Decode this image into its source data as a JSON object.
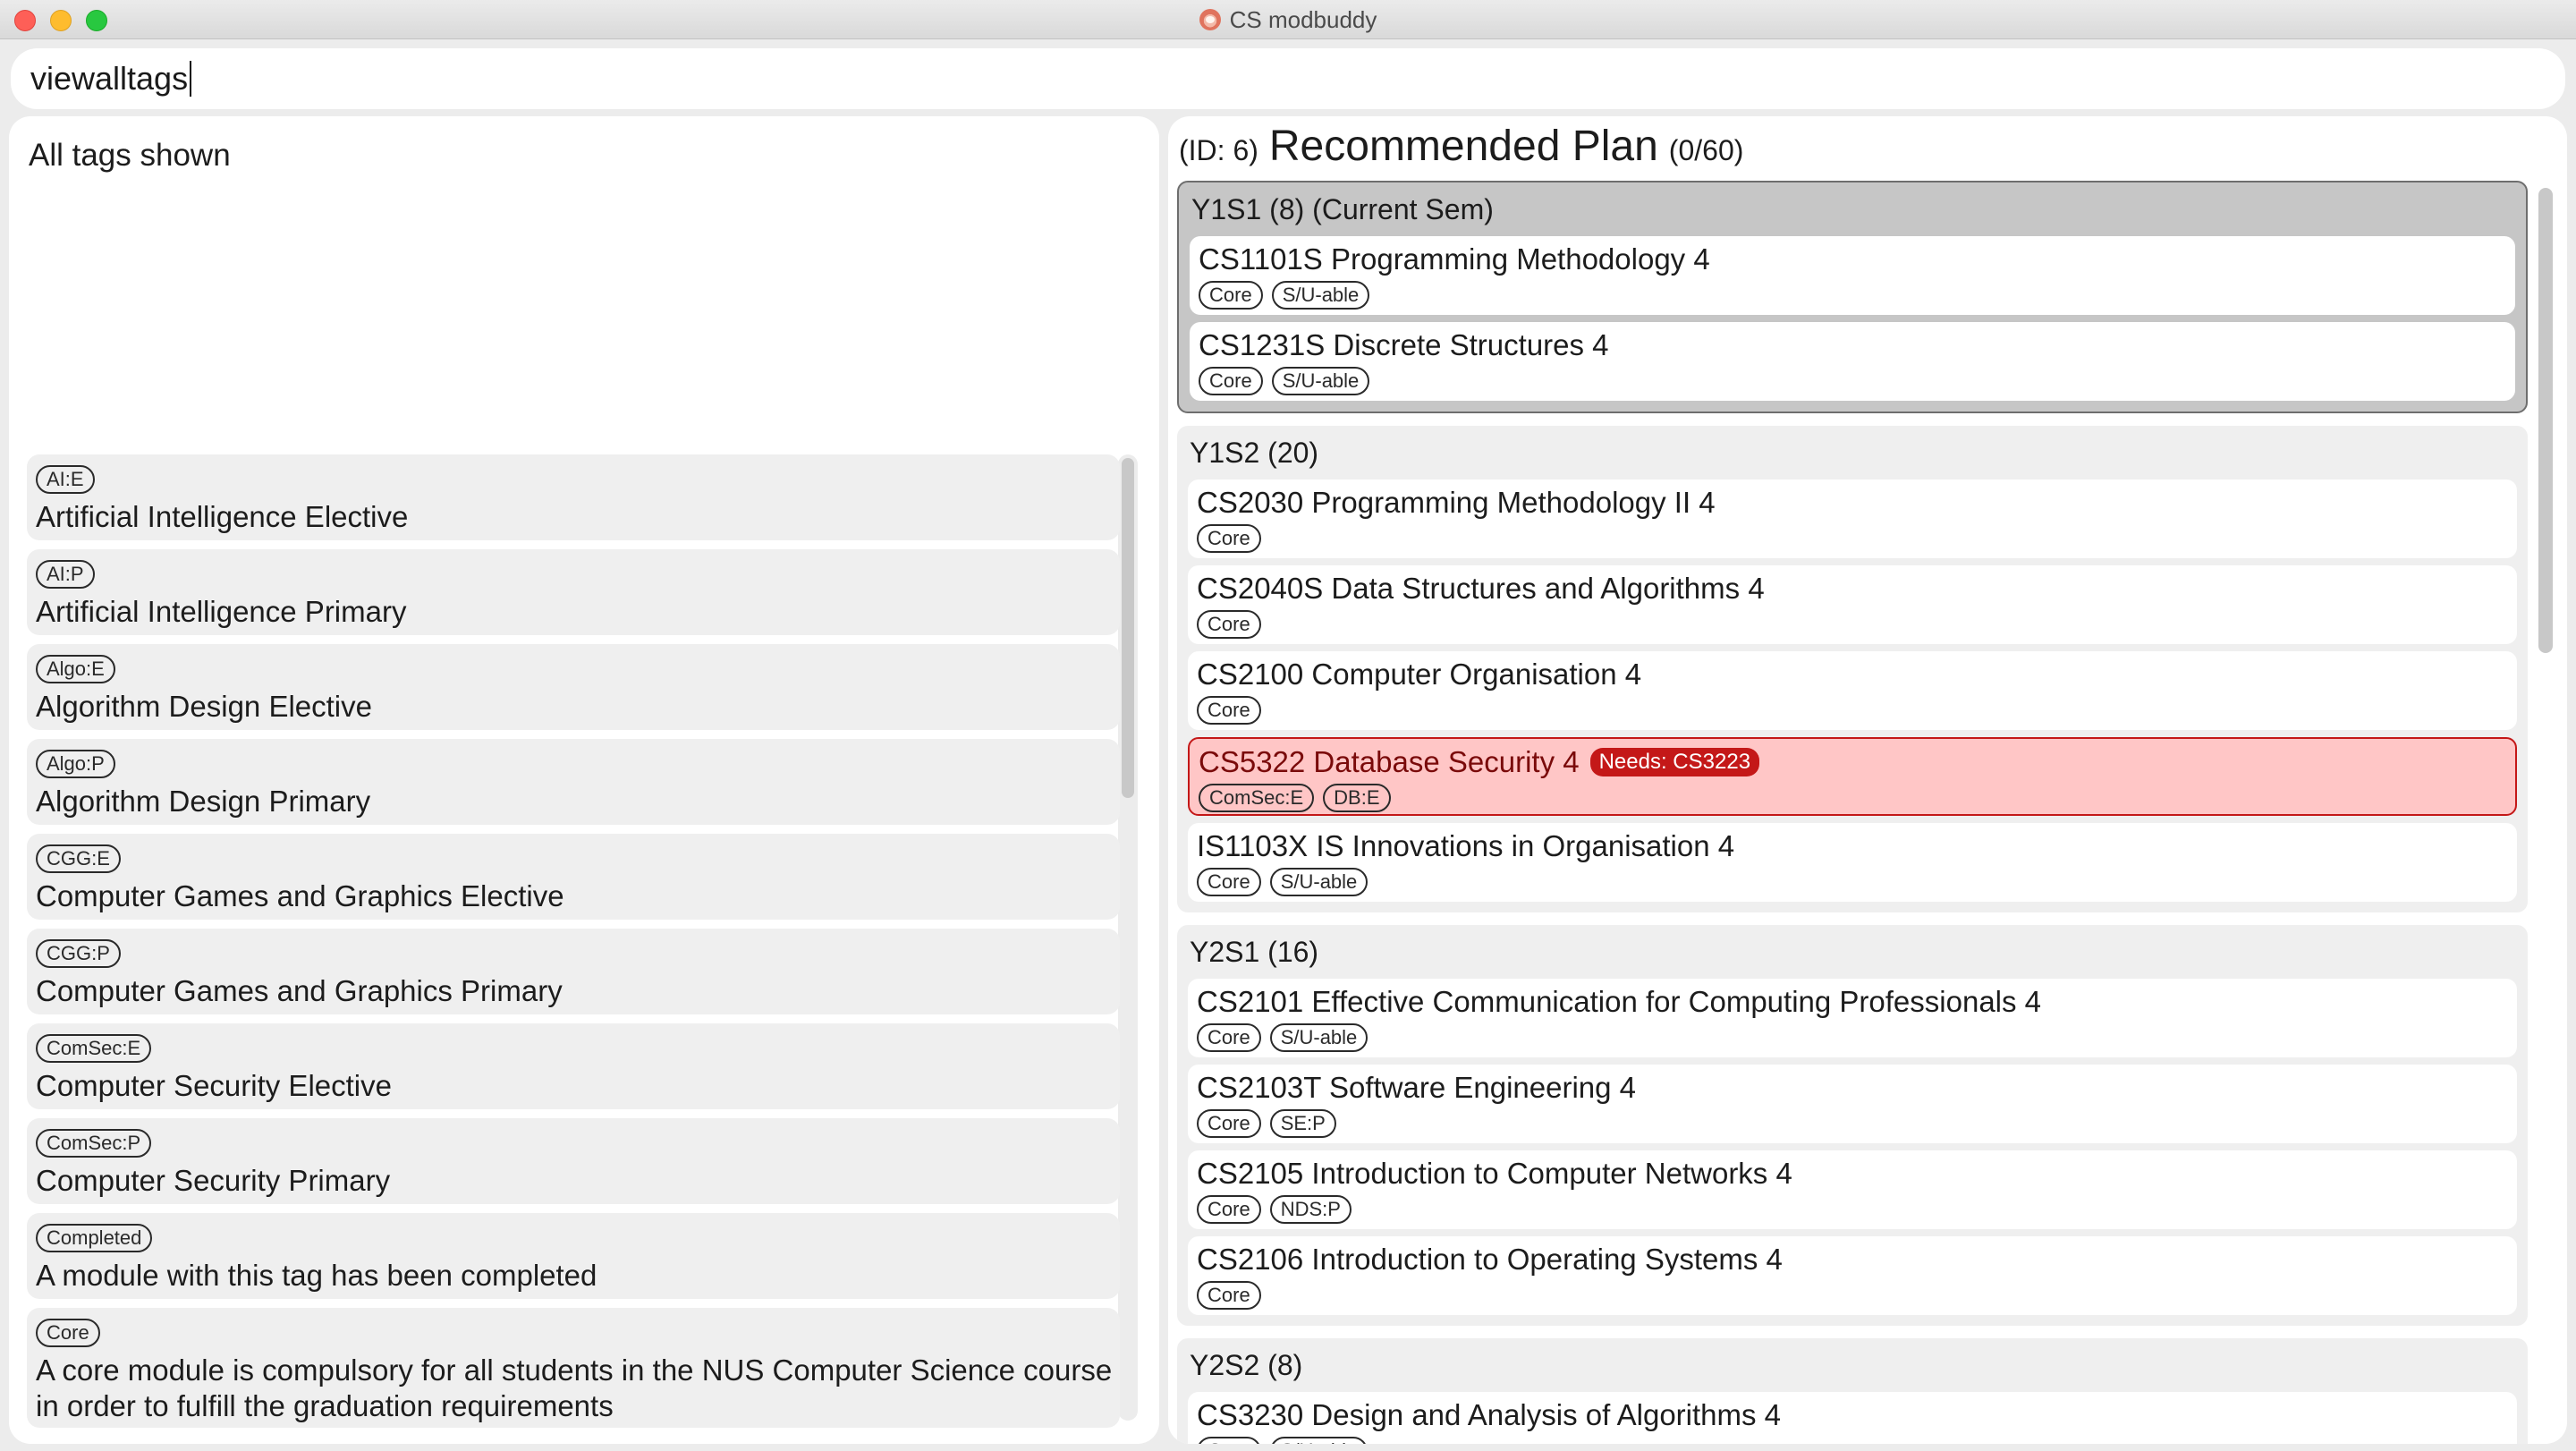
{
  "window": {
    "title": "CS modbuddy"
  },
  "command": {
    "value": "viewalltags"
  },
  "result": {
    "text": "All tags shown"
  },
  "tags": [
    {
      "code": "AI:E",
      "description": "Artificial Intelligence Elective"
    },
    {
      "code": "AI:P",
      "description": "Artificial Intelligence Primary"
    },
    {
      "code": "Algo:E",
      "description": "Algorithm Design Elective"
    },
    {
      "code": "Algo:P",
      "description": "Algorithm Design Primary"
    },
    {
      "code": "CGG:E",
      "description": "Computer Games and Graphics Elective"
    },
    {
      "code": "CGG:P",
      "description": "Computer Games and Graphics Primary"
    },
    {
      "code": "ComSec:E",
      "description": "Computer Security Elective"
    },
    {
      "code": "ComSec:P",
      "description": "Computer Security Primary"
    },
    {
      "code": "Completed",
      "description": "A module with this tag has been completed"
    },
    {
      "code": "Core",
      "description": "A core module is compulsory for all students in the NUS Computer Science course in order to fulfill the graduation requirements"
    }
  ],
  "plan": {
    "id_label": "(ID: 6)",
    "name": "Recommended Plan",
    "mc_label": "(0/60)",
    "semesters": [
      {
        "title": "Y1S1 (8) (Current Sem)",
        "current": true,
        "modules": [
          {
            "title": "CS1101S Programming Methodology 4",
            "tags": [
              "Core",
              "S/U-able"
            ]
          },
          {
            "title": "CS1231S Discrete Structures 4",
            "tags": [
              "Core",
              "S/U-able"
            ]
          }
        ]
      },
      {
        "title": "Y1S2 (20)",
        "current": false,
        "modules": [
          {
            "title": "CS2030 Programming Methodology II 4",
            "tags": [
              "Core"
            ]
          },
          {
            "title": "CS2040S Data Structures and Algorithms 4",
            "tags": [
              "Core"
            ]
          },
          {
            "title": "CS2100 Computer Organisation 4",
            "tags": [
              "Core"
            ]
          },
          {
            "title": "CS5322 Database Security 4",
            "tags": [
              "ComSec:E",
              "DB:E"
            ],
            "warning": "Needs: CS3223"
          },
          {
            "title": "IS1103X IS Innovations in Organisation 4",
            "tags": [
              "Core",
              "S/U-able"
            ]
          }
        ]
      },
      {
        "title": "Y2S1 (16)",
        "current": false,
        "modules": [
          {
            "title": "CS2101 Effective Communication for Computing Professionals 4",
            "tags": [
              "Core",
              "S/U-able"
            ]
          },
          {
            "title": "CS2103T Software Engineering 4",
            "tags": [
              "Core",
              "SE:P"
            ]
          },
          {
            "title": "CS2105 Introduction to Computer Networks 4",
            "tags": [
              "Core",
              "NDS:P"
            ]
          },
          {
            "title": "CS2106 Introduction to Operating Systems 4",
            "tags": [
              "Core"
            ]
          }
        ]
      },
      {
        "title": "Y2S2 (8)",
        "current": false,
        "modules": [
          {
            "title": "CS3230 Design and Analysis of Algorithms 4",
            "tags": [
              "Core",
              "S/U-able"
            ]
          }
        ]
      }
    ]
  }
}
